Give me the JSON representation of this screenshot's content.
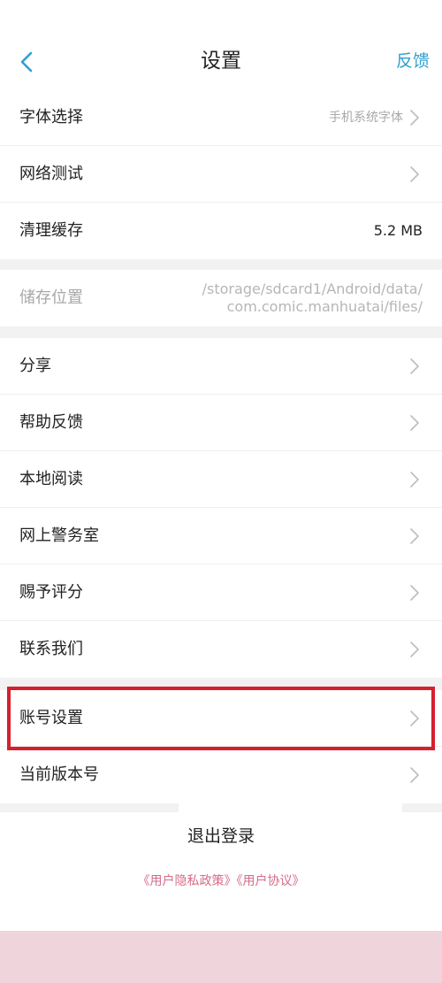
{
  "header": {
    "title": "设置",
    "feedback_label": "反馈",
    "back_icon": "chevron-left-icon",
    "accent_color": "#2f9fd1"
  },
  "group1": {
    "font": {
      "label": "字体选择",
      "value": "手机系统字体"
    },
    "network": {
      "label": "网络测试"
    },
    "cache": {
      "label": "清理缓存",
      "value": "5.2 MB"
    }
  },
  "storage": {
    "label": "储存位置",
    "path_line1": "/storage/sdcard1/Android/data/",
    "path_line2": "com.comic.manhuatai/files/"
  },
  "group2": {
    "share": {
      "label": "分享"
    },
    "help": {
      "label": "帮助反馈"
    },
    "local": {
      "label": "本地阅读"
    },
    "police": {
      "label": "网上警务室"
    },
    "rate": {
      "label": "赐予评分"
    },
    "contact": {
      "label": "联系我们"
    }
  },
  "group3": {
    "account": {
      "label": "账号设置"
    },
    "version": {
      "label": "当前版本号"
    }
  },
  "footer": {
    "logout_label": "退出登录",
    "privacy_link": "《用户隐私政策》",
    "agreement_link": "《用户协议》"
  },
  "colors": {
    "highlight": "#d6202e",
    "policy_link": "#d66b88",
    "bottom_band": "#f0d4db"
  }
}
